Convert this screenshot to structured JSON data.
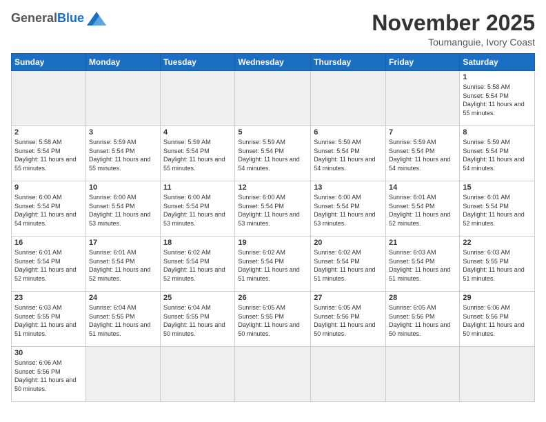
{
  "header": {
    "logo_general": "General",
    "logo_blue": "Blue",
    "month_title": "November 2025",
    "location": "Toumanguie, Ivory Coast"
  },
  "days_of_week": [
    "Sunday",
    "Monday",
    "Tuesday",
    "Wednesday",
    "Thursday",
    "Friday",
    "Saturday"
  ],
  "weeks": [
    [
      {
        "day": "",
        "empty": true
      },
      {
        "day": "",
        "empty": true
      },
      {
        "day": "",
        "empty": true
      },
      {
        "day": "",
        "empty": true
      },
      {
        "day": "",
        "empty": true
      },
      {
        "day": "",
        "empty": true
      },
      {
        "day": "1",
        "info": "Sunrise: 5:58 AM\nSunset: 5:54 PM\nDaylight: 11 hours\nand 55 minutes."
      }
    ],
    [
      {
        "day": "2",
        "info": "Sunrise: 5:58 AM\nSunset: 5:54 PM\nDaylight: 11 hours\nand 55 minutes."
      },
      {
        "day": "3",
        "info": "Sunrise: 5:59 AM\nSunset: 5:54 PM\nDaylight: 11 hours\nand 55 minutes."
      },
      {
        "day": "4",
        "info": "Sunrise: 5:59 AM\nSunset: 5:54 PM\nDaylight: 11 hours\nand 55 minutes."
      },
      {
        "day": "5",
        "info": "Sunrise: 5:59 AM\nSunset: 5:54 PM\nDaylight: 11 hours\nand 54 minutes."
      },
      {
        "day": "6",
        "info": "Sunrise: 5:59 AM\nSunset: 5:54 PM\nDaylight: 11 hours\nand 54 minutes."
      },
      {
        "day": "7",
        "info": "Sunrise: 5:59 AM\nSunset: 5:54 PM\nDaylight: 11 hours\nand 54 minutes."
      },
      {
        "day": "8",
        "info": "Sunrise: 5:59 AM\nSunset: 5:54 PM\nDaylight: 11 hours\nand 54 minutes."
      }
    ],
    [
      {
        "day": "9",
        "info": "Sunrise: 6:00 AM\nSunset: 5:54 PM\nDaylight: 11 hours\nand 54 minutes."
      },
      {
        "day": "10",
        "info": "Sunrise: 6:00 AM\nSunset: 5:54 PM\nDaylight: 11 hours\nand 53 minutes."
      },
      {
        "day": "11",
        "info": "Sunrise: 6:00 AM\nSunset: 5:54 PM\nDaylight: 11 hours\nand 53 minutes."
      },
      {
        "day": "12",
        "info": "Sunrise: 6:00 AM\nSunset: 5:54 PM\nDaylight: 11 hours\nand 53 minutes."
      },
      {
        "day": "13",
        "info": "Sunrise: 6:00 AM\nSunset: 5:54 PM\nDaylight: 11 hours\nand 53 minutes."
      },
      {
        "day": "14",
        "info": "Sunrise: 6:01 AM\nSunset: 5:54 PM\nDaylight: 11 hours\nand 52 minutes."
      },
      {
        "day": "15",
        "info": "Sunrise: 6:01 AM\nSunset: 5:54 PM\nDaylight: 11 hours\nand 52 minutes."
      }
    ],
    [
      {
        "day": "16",
        "info": "Sunrise: 6:01 AM\nSunset: 5:54 PM\nDaylight: 11 hours\nand 52 minutes."
      },
      {
        "day": "17",
        "info": "Sunrise: 6:01 AM\nSunset: 5:54 PM\nDaylight: 11 hours\nand 52 minutes."
      },
      {
        "day": "18",
        "info": "Sunrise: 6:02 AM\nSunset: 5:54 PM\nDaylight: 11 hours\nand 52 minutes."
      },
      {
        "day": "19",
        "info": "Sunrise: 6:02 AM\nSunset: 5:54 PM\nDaylight: 11 hours\nand 51 minutes."
      },
      {
        "day": "20",
        "info": "Sunrise: 6:02 AM\nSunset: 5:54 PM\nDaylight: 11 hours\nand 51 minutes."
      },
      {
        "day": "21",
        "info": "Sunrise: 6:03 AM\nSunset: 5:54 PM\nDaylight: 11 hours\nand 51 minutes."
      },
      {
        "day": "22",
        "info": "Sunrise: 6:03 AM\nSunset: 5:55 PM\nDaylight: 11 hours\nand 51 minutes."
      }
    ],
    [
      {
        "day": "23",
        "info": "Sunrise: 6:03 AM\nSunset: 5:55 PM\nDaylight: 11 hours\nand 51 minutes."
      },
      {
        "day": "24",
        "info": "Sunrise: 6:04 AM\nSunset: 5:55 PM\nDaylight: 11 hours\nand 51 minutes."
      },
      {
        "day": "25",
        "info": "Sunrise: 6:04 AM\nSunset: 5:55 PM\nDaylight: 11 hours\nand 50 minutes."
      },
      {
        "day": "26",
        "info": "Sunrise: 6:05 AM\nSunset: 5:55 PM\nDaylight: 11 hours\nand 50 minutes."
      },
      {
        "day": "27",
        "info": "Sunrise: 6:05 AM\nSunset: 5:56 PM\nDaylight: 11 hours\nand 50 minutes."
      },
      {
        "day": "28",
        "info": "Sunrise: 6:05 AM\nSunset: 5:56 PM\nDaylight: 11 hours\nand 50 minutes."
      },
      {
        "day": "29",
        "info": "Sunrise: 6:06 AM\nSunset: 5:56 PM\nDaylight: 11 hours\nand 50 minutes."
      }
    ],
    [
      {
        "day": "30",
        "info": "Sunrise: 6:06 AM\nSunset: 5:56 PM\nDaylight: 11 hours\nand 50 minutes."
      },
      {
        "day": "",
        "empty": true
      },
      {
        "day": "",
        "empty": true
      },
      {
        "day": "",
        "empty": true
      },
      {
        "day": "",
        "empty": true
      },
      {
        "day": "",
        "empty": true
      },
      {
        "day": "",
        "empty": true
      }
    ]
  ]
}
